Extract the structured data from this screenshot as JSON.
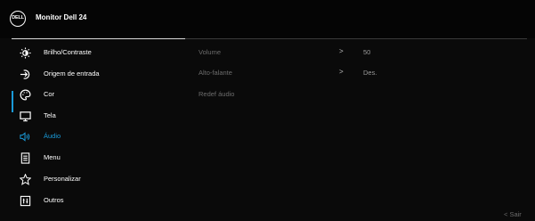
{
  "header": {
    "logo_text": "DELL",
    "title": "Monitor Dell 24"
  },
  "menu": [
    {
      "label": "Brilho/Contraste",
      "icon": "brightness-icon"
    },
    {
      "label": "Origem de entrada",
      "icon": "input-source-icon"
    },
    {
      "label": "Cor",
      "icon": "palette-icon"
    },
    {
      "label": "Tela",
      "icon": "display-icon"
    },
    {
      "label": "Áudio",
      "icon": "speaker-icon",
      "active": true
    },
    {
      "label": "Menu",
      "icon": "menu-icon"
    },
    {
      "label": "Personalizar",
      "icon": "star-icon"
    },
    {
      "label": "Outros",
      "icon": "others-icon"
    }
  ],
  "audio": {
    "volume_label": "Volume",
    "volume_value": "50",
    "speaker_label": "Alto-falante",
    "speaker_value": "Des.",
    "reset_label": "Redef áudio"
  },
  "footer": {
    "exit_label": "< Sair"
  },
  "colors": {
    "accent": "#1a9ad8",
    "background": "#0a0a0a",
    "disabled_text": "#6c6c6c"
  }
}
